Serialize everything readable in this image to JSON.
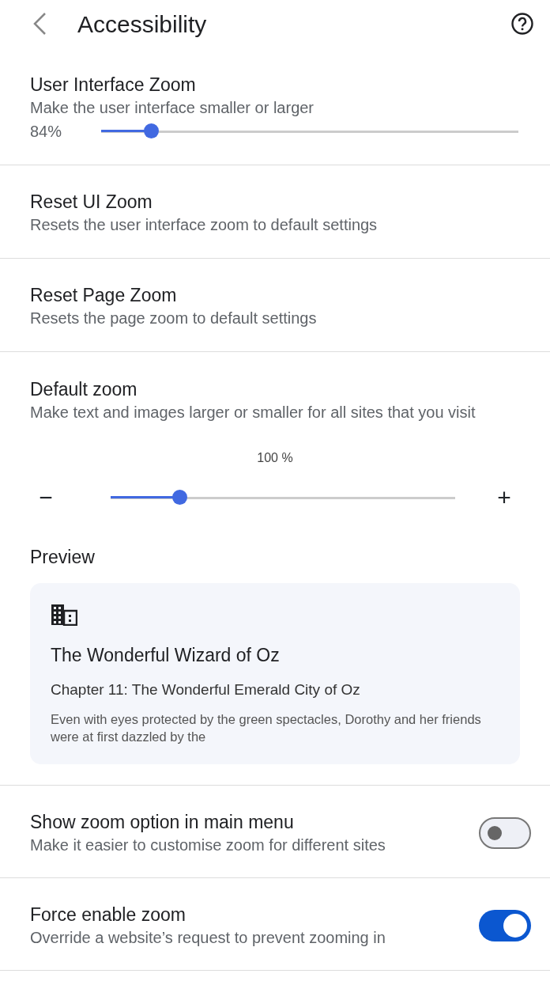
{
  "header": {
    "title": "Accessibility"
  },
  "settings": [
    {
      "kind": "slider",
      "title": "User Interface Zoom",
      "description": "Make the user interface smaller or larger",
      "reading": "84%",
      "level": 0.12
    },
    {
      "kind": "action",
      "title": "Reset UI Zoom",
      "description": "Resets the user interface zoom to default settings"
    },
    {
      "kind": "action",
      "title": "Reset Page Zoom",
      "description": "Resets the page zoom to default settings"
    },
    {
      "kind": "zoom",
      "title": "Default zoom",
      "description": "Make text and images larger or smaller for all sites that you visit",
      "reading": "100 %",
      "minus": "−",
      "plus": "+",
      "level": 0.2,
      "preview_label": "Preview",
      "preview": {
        "book_title": "The Wonderful Wizard of Oz",
        "chapter": "Chapter 11: The Wonderful Emerald City of Oz",
        "excerpt": "Even with eyes protected by the green spectacles, Dorothy and her friends were at first dazzled by the"
      }
    },
    {
      "kind": "toggle",
      "title": "Show zoom option in main menu",
      "description": "Make it easier to customise zoom for different sites",
      "on": false
    },
    {
      "kind": "toggle",
      "title": "Force enable zoom",
      "description": "Override a website’s request to prevent zooming in",
      "on": true
    }
  ]
}
